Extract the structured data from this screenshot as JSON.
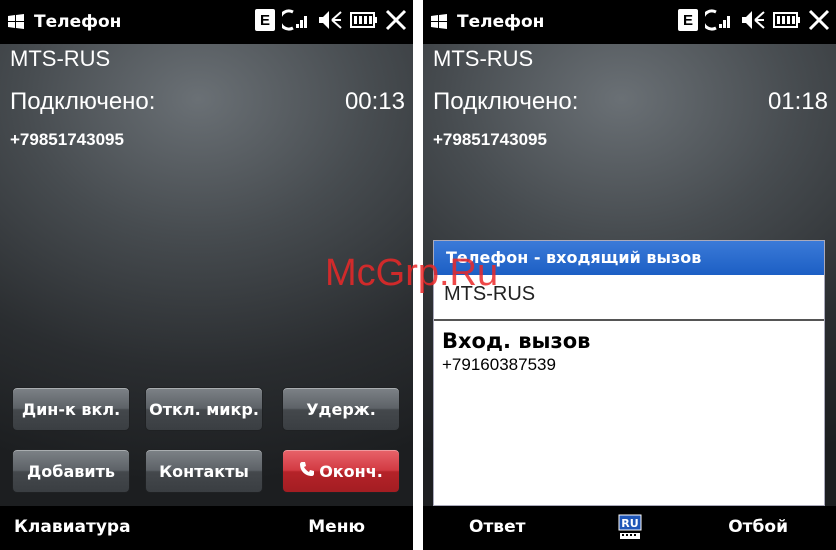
{
  "left": {
    "status": {
      "title": "Телефон"
    },
    "call": {
      "carrier": "MTS-RUS",
      "state": "Подключено:",
      "timer": "00:13",
      "number": "+79851743095"
    },
    "buttons": {
      "speaker": "Дин-к вкл.",
      "mute": "Откл. микр.",
      "hold": "Удерж.",
      "add": "Добавить",
      "contacts": "Контакты",
      "end": "Оконч."
    },
    "softkeys": {
      "left": "Клавиатура",
      "right": "Меню"
    }
  },
  "right": {
    "status": {
      "title": "Телефон"
    },
    "call": {
      "carrier": "MTS-RUS",
      "state": "Подключено:",
      "timer": "01:18",
      "number": "+79851743095"
    },
    "dialog": {
      "title": "Телефон - входящий вызов",
      "carrier": "MTS-RUS",
      "heading": "Вход. вызов",
      "number": "+79160387539"
    },
    "softkeys": {
      "left": "Ответ",
      "center_badge": "RU",
      "right": "Отбой"
    }
  },
  "watermark": "McGrp.Ru",
  "colors": {
    "end_call": "#c8323a",
    "dialog_title": "#2a6acd",
    "status_bar": "#000000"
  }
}
